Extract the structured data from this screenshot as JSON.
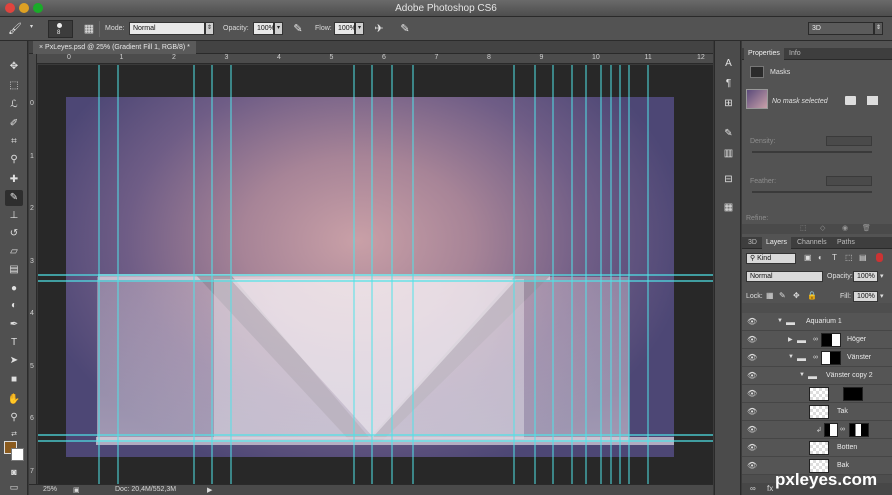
{
  "window": {
    "title": "Adobe Photoshop CS6"
  },
  "options_bar": {
    "brush_size": "8",
    "mode_label": "Mode:",
    "mode_value": "Normal",
    "opacity_label": "Opacity:",
    "opacity_value": "100%",
    "flow_label": "Flow:",
    "flow_value": "100%",
    "workspace": "3D"
  },
  "document": {
    "tab_title": "PxLeyes.psd @ 25% (Gradient Fill 1, RGB/8) *",
    "ruler_h": [
      "0",
      "1",
      "2",
      "3",
      "4",
      "5",
      "6",
      "7",
      "8",
      "9",
      "10",
      "11",
      "12"
    ],
    "ruler_v": [
      "0",
      "1",
      "2",
      "3",
      "4",
      "5",
      "6",
      "7"
    ]
  },
  "status_bar": {
    "zoom": "25%",
    "doc_info": "Doc: 20,4M/552,3M"
  },
  "properties_panel": {
    "tabs": [
      "Properties",
      "Info"
    ],
    "header": "Masks",
    "no_mask": "No mask selected",
    "density_label": "Density:",
    "feather_label": "Feather:",
    "refine_label": "Refine:"
  },
  "layers_panel": {
    "tabs": [
      "3D",
      "Layers",
      "Channels",
      "Paths"
    ],
    "filter": "Kind",
    "blend_mode": "Normal",
    "opacity_label": "Opacity:",
    "opacity_value": "100%",
    "lock_label": "Lock:",
    "fill_label": "Fill:",
    "fill_value": "100%",
    "layers": [
      {
        "name": "Aquarium 1"
      },
      {
        "name": "Höger"
      },
      {
        "name": "Vänster"
      },
      {
        "name": "Vänster copy 2"
      },
      {
        "name": ""
      },
      {
        "name": "Tak"
      },
      {
        "name": ""
      },
      {
        "name": "Botten"
      },
      {
        "name": "Bak"
      }
    ]
  },
  "watermark": "pxleyes.com",
  "colors": {
    "foreground": "#8b5b1e",
    "background": "#ffffff",
    "guide": "#4fe3e8"
  },
  "icons": {
    "tools": [
      "move-icon",
      "marquee-icon",
      "lasso-icon",
      "quick-select-icon",
      "crop-icon",
      "eyedropper-icon",
      "healing-icon",
      "brush-icon",
      "stamp-icon",
      "history-brush-icon",
      "eraser-icon",
      "gradient-icon",
      "blur-icon",
      "dodge-icon",
      "pen-icon",
      "type-icon",
      "path-select-icon",
      "shape-icon",
      "hand-icon",
      "zoom-icon"
    ]
  }
}
